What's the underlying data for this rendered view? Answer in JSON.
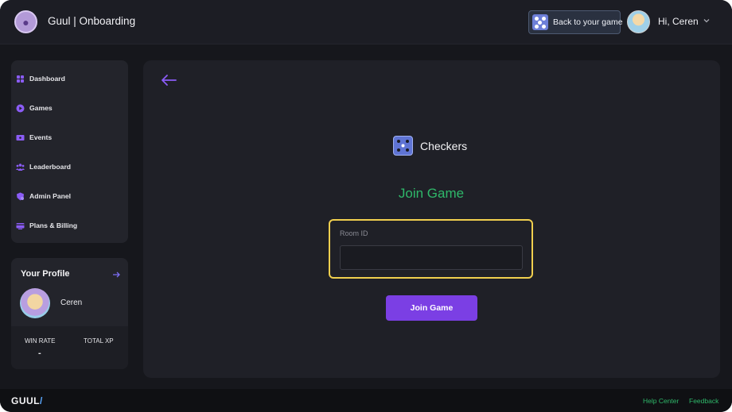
{
  "header": {
    "app_title": "Guul | Onboarding",
    "back_to_game_label": "Back to your game",
    "greeting": "Hi, Ceren"
  },
  "sidebar": {
    "items": [
      {
        "label": "Dashboard",
        "icon": "grid-icon"
      },
      {
        "label": "Games",
        "icon": "play-icon"
      },
      {
        "label": "Events",
        "icon": "ticket-icon"
      },
      {
        "label": "Leaderboard",
        "icon": "users-icon"
      },
      {
        "label": "Admin Panel",
        "icon": "shield-icon"
      },
      {
        "label": "Plans & Billing",
        "icon": "card-icon"
      }
    ]
  },
  "profile": {
    "title": "Your Profile",
    "name": "Ceren",
    "stats": [
      {
        "label": "WIN RATE",
        "value": "-"
      },
      {
        "label": "TOTAL XP",
        "value": ""
      }
    ]
  },
  "main": {
    "game_name": "Checkers",
    "join_title": "Join Game",
    "room_label": "Room ID",
    "room_value": "",
    "room_placeholder": "",
    "join_button_label": "Join Game"
  },
  "footer": {
    "logo": "GUUL",
    "logo_slash": "/",
    "links": [
      "Help Center",
      "Feedback"
    ]
  },
  "colors": {
    "accent": "#7b3fe4",
    "success": "#2fb86a",
    "highlight": "#f0cf4e",
    "background": "#16171c"
  }
}
